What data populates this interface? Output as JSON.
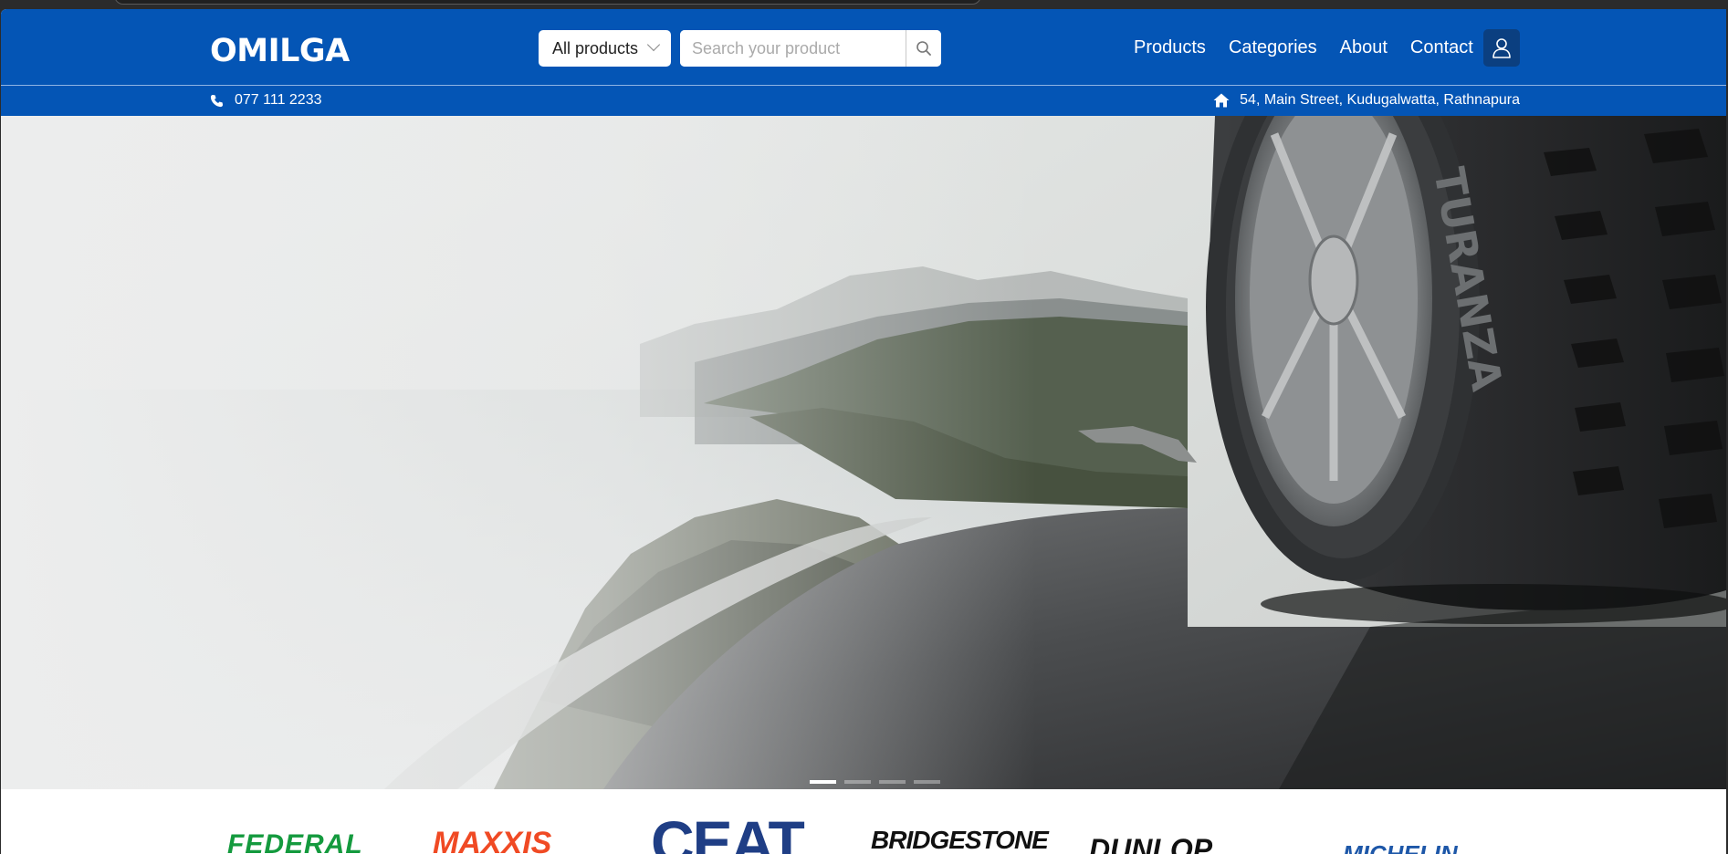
{
  "app": {
    "logo": "OMILGA"
  },
  "search": {
    "category_selected": "All products",
    "placeholder": "Search your product",
    "value": ""
  },
  "nav": {
    "items": [
      {
        "label": "Products"
      },
      {
        "label": "Categories"
      },
      {
        "label": "About"
      },
      {
        "label": "Contact"
      }
    ]
  },
  "contact": {
    "phone": "077 111 2233",
    "address": "54, Main Street, Kudugalwatta, Rathnapura"
  },
  "hero": {
    "slides_total": 4,
    "active_slide": 1,
    "tire_sidewall_text": "TURANZA"
  },
  "brands": {
    "items": [
      {
        "name": "FEDERAL",
        "color": "#149a3e"
      },
      {
        "name": "MAXXIS",
        "color": "#f04a24"
      },
      {
        "name": "CEAT",
        "color": "#1f3e85"
      },
      {
        "name": "BRIDGESTONE",
        "color": "#111111"
      },
      {
        "name": "DUNLOP",
        "color": "#111111"
      },
      {
        "name": "MICHELIN",
        "color": "#1d57a8"
      }
    ]
  },
  "colors": {
    "header_bg": "#0455b5",
    "user_button_bg": "#0b3f80"
  },
  "icons": {
    "search": "magnifier-icon",
    "user": "user-icon",
    "phone": "phone-icon",
    "home": "home-icon",
    "dropdown": "chevron-down-icon"
  }
}
